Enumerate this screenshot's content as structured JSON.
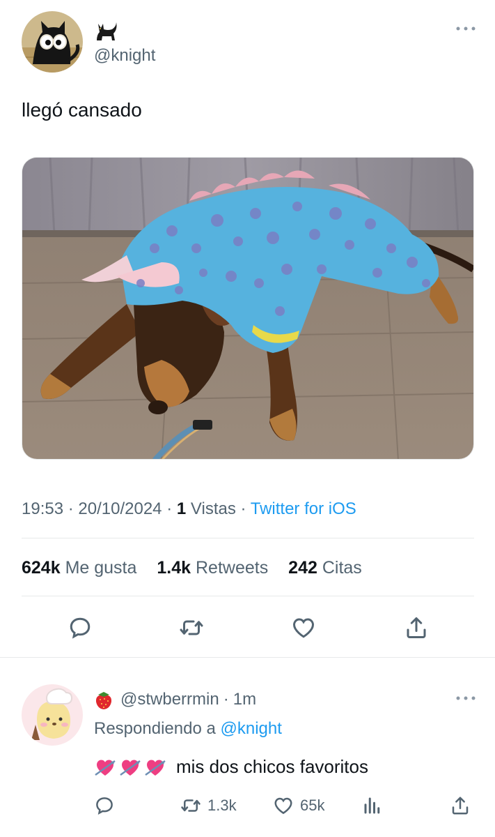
{
  "tweet": {
    "display_name_icon": "black-cat-emoji",
    "handle": "@knight",
    "text": "llegó cansado",
    "time": "19:53",
    "date": "20/10/2024",
    "views_count": "1",
    "views_label": "Vistas",
    "client": "Twitter for iOS",
    "likes_count": "624k",
    "likes_label": "Me gusta",
    "retweets_count": "1.4k",
    "retweets_label": "Retweets",
    "quotes_count": "242",
    "quotes_label": "Citas",
    "separator": "·"
  },
  "actions": [
    "reply-icon",
    "retweet-icon",
    "like-icon",
    "share-icon"
  ],
  "reply": {
    "name_icon": "strawberry-emoji",
    "handle": "@stwberrmin",
    "time": "1m",
    "replying_prefix": "Respondiendo a",
    "replying_to": "@knight",
    "emoji": [
      "heart-with-arrow-emoji",
      "heart-with-arrow-emoji",
      "heart-with-arrow-emoji"
    ],
    "text": "mis dos chicos favoritos",
    "retweets": "1.3k",
    "likes": "65k"
  },
  "colors": {
    "accent": "#1d9bf0",
    "secondary_text": "#536471",
    "divider": "#e7e9ea"
  }
}
